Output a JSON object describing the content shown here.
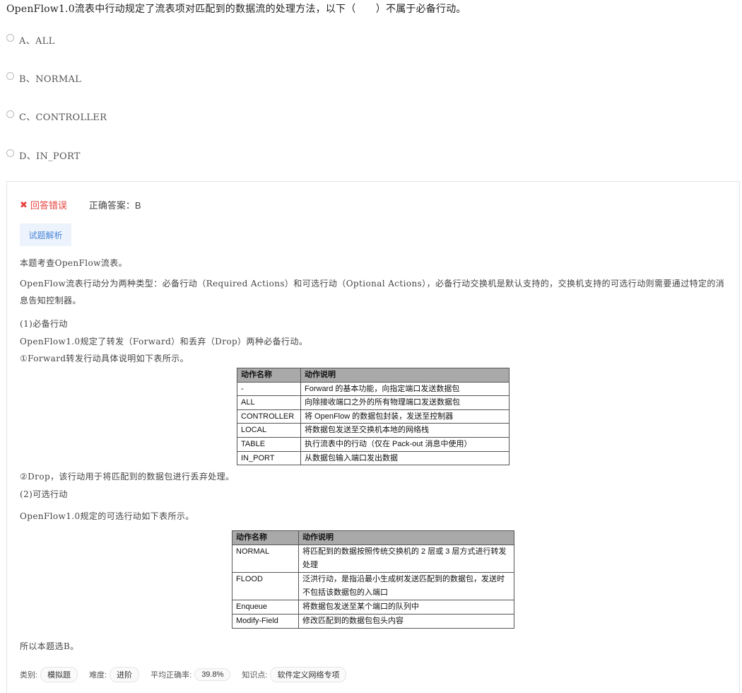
{
  "question": "OpenFlow1.0流表中行动规定了流表项对匹配到的数据流的处理方法，以下（　　）不属于必备行动。",
  "options": [
    {
      "label": "A、ALL"
    },
    {
      "label": "B、NORMAL"
    },
    {
      "label": "C、CONTROLLER"
    },
    {
      "label": "D、IN_PORT"
    }
  ],
  "result": {
    "icon": "✖",
    "status": "回答错误",
    "correct_answer": "正确答案：B"
  },
  "analysis_button": "试题解析",
  "analysis": {
    "p1": "本题考查OpenFlow流表。",
    "p2": "OpenFlow流表行动分为两种类型：必备行动（Required Actions）和可选行动（Optional Actions），必备行动交换机是默认支持的，交换机支持的可选行动则需要通过特定的消息告知控制器。",
    "p3": "(1)必备行动",
    "p4": "OpenFlow1.0规定了转发（Forward）和丢弃（Drop）两种必备行动。",
    "p5": "①Forward转发行动具体说明如下表所示。",
    "p6": "②Drop，该行动用于将匹配到的数据包进行丢弃处理。",
    "p7": "(2)可选行动",
    "p8": "OpenFlow1.0规定的可选行动如下表所示。",
    "p9": "所以本题选B。"
  },
  "table1": {
    "headers": [
      "动作名称",
      "动作说明"
    ],
    "rows": [
      [
        "-",
        "Forward 的基本功能，向指定端口发送数据包"
      ],
      [
        "ALL",
        "向除接收端口之外的所有物理端口发送数据包"
      ],
      [
        "CONTROLLER",
        "将 OpenFlow 的数据包封装，发送至控制器"
      ],
      [
        "LOCAL",
        "将数据包发送至交换机本地的网络栈"
      ],
      [
        "TABLE",
        "执行流表中的行动（仅在 Pack-out 消息中使用）"
      ],
      [
        "IN_PORT",
        "从数据包输入端口发出数据"
      ]
    ]
  },
  "table2": {
    "headers": [
      "动作名称",
      "动作说明"
    ],
    "rows": [
      [
        "NORMAL",
        "将匹配到的数据按照传统交换机的 2 层或 3 层方式进行转发处理"
      ],
      [
        "FLOOD",
        "泛洪行动，是指沿最小生成树发送匹配到的数据包，发送时不包括该数据包的入端口"
      ],
      [
        "Enqueue",
        "将数据包发送至某个端口的队列中"
      ],
      [
        "Modify-Field",
        "修改匹配到的数据包包头内容"
      ]
    ]
  },
  "meta": {
    "category_label": "类别:",
    "category": "模拟题",
    "difficulty_label": "难度:",
    "difficulty": "进阶",
    "accuracy_label": "平均正确率:",
    "accuracy": "39.8%",
    "topic_label": "知识点:",
    "topic": "软件定义网络专项"
  }
}
